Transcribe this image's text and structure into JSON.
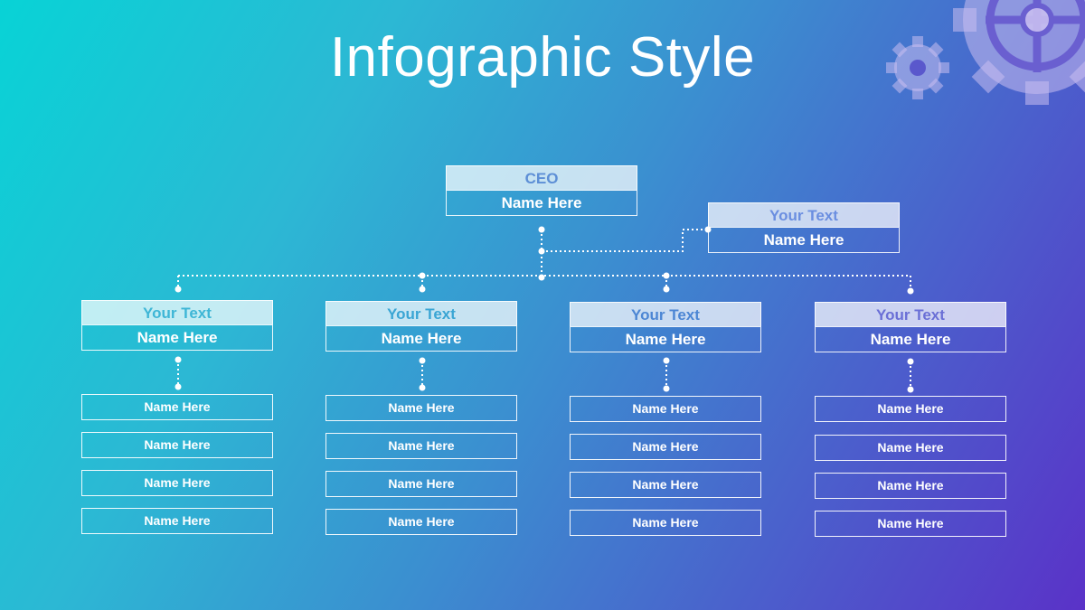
{
  "title": "Infographic Style",
  "ceo": {
    "role": "CEO",
    "name": "Name Here"
  },
  "assistant": {
    "role": "Your Text",
    "name": "Name Here"
  },
  "departments": [
    {
      "role": "Your Text",
      "name": "Name Here",
      "members": [
        "Name Here",
        "Name Here",
        "Name Here",
        "Name Here"
      ]
    },
    {
      "role": "Your Text",
      "name": "Name Here",
      "members": [
        "Name Here",
        "Name Here",
        "Name Here",
        "Name Here"
      ]
    },
    {
      "role": "Your Text",
      "name": "Name Here",
      "members": [
        "Name Here",
        "Name Here",
        "Name Here",
        "Name Here"
      ]
    },
    {
      "role": "Your Text",
      "name": "Name Here",
      "members": [
        "Name Here",
        "Name Here",
        "Name Here",
        "Name Here"
      ]
    }
  ],
  "icons": [
    "gear-icon-small",
    "gear-icon-large"
  ]
}
